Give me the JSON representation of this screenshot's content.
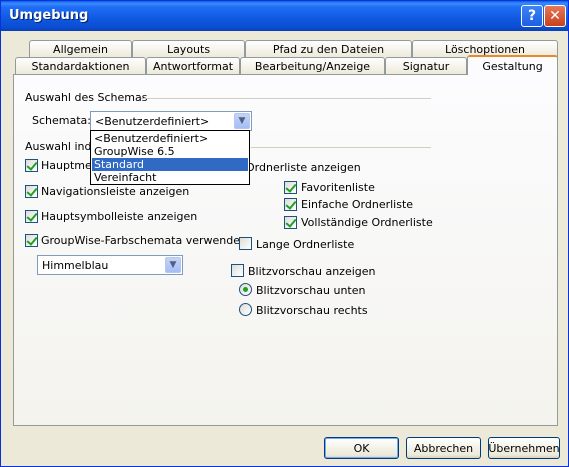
{
  "window": {
    "title": "Umgebung"
  },
  "titlebar": {
    "help_glyph": "?",
    "close_glyph": "✕"
  },
  "tabs": {
    "row_back": [
      "Allgemein",
      "Layouts",
      "Pfad zu den Dateien",
      "Löschoptionen"
    ],
    "row_front": [
      "Standardaktionen",
      "Antwortformat",
      "Bearbeitung/Anzeige",
      "Signatur",
      "Gestaltung"
    ],
    "active": "Gestaltung"
  },
  "schema_group": {
    "title": "Auswahl des Schemas",
    "label": "Schemata:",
    "value": "<Benutzerdefiniert>",
    "options": [
      "<Benutzerdefiniert>",
      "GroupWise 6.5",
      "Standard",
      "Vereinfacht"
    ],
    "highlighted": "Standard"
  },
  "individual_group": {
    "title_visible": "Auswahl indiv",
    "items": [
      {
        "label": "Hauptmen",
        "checked": true
      },
      {
        "label": "Navigationsleiste anzeigen",
        "checked": true
      },
      {
        "label": "Hauptsymbolleiste anzeigen",
        "checked": true
      },
      {
        "label": "GroupWise-Farbschemata verwenden",
        "checked": true
      }
    ],
    "color_scheme": "Himmelblau"
  },
  "right_group": {
    "folder_list": {
      "label": "Ordnerliste anzeigen"
    },
    "folder_items": [
      {
        "label": "Favoritenliste",
        "checked": true
      },
      {
        "label": "Einfache Ordnerliste",
        "checked": true
      },
      {
        "label": "Vollständige Ordnerliste",
        "checked": true
      }
    ],
    "long_folder": {
      "label": "Lange Ordnerliste",
      "checked": false
    },
    "quick_viewer": {
      "label": "Blitzvorschau anzeigen",
      "checked": false
    },
    "quick_viewer_pos": [
      {
        "label": "Blitzvorschau unten",
        "checked": true
      },
      {
        "label": "Blitzvorschau rechts",
        "checked": false
      }
    ]
  },
  "buttons": {
    "ok": "OK",
    "cancel": "Abbrechen",
    "apply": "Übernehmen"
  },
  "colors": {
    "title_blue": "#0a4cd0",
    "active_tab_accent": "#e68b2c",
    "selection": "#316ac5",
    "check_green": "#21a121"
  }
}
